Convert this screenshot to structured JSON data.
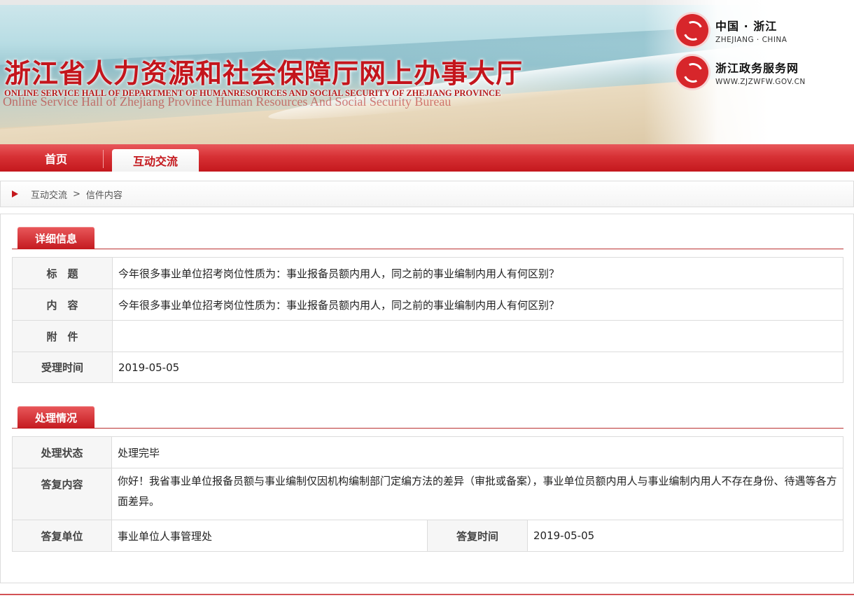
{
  "header": {
    "title": "浙江省人力资源和社会保障厅网上办事大厅",
    "subtitle_en": "ONLINE SERVICE HALL OF DEPARTMENT OF HUMANRESOURCES AND SOCIAL SECURITY OF ZHEJIANG PROVINCE",
    "subtitle_en_2": "Online Service Hall of Zhejiang Province Human Resources And Social Security Bureau",
    "badge_top": {
      "zh": "中国 · 浙江",
      "en": "ZHEJIANG · CHINA"
    },
    "badge_bottom": {
      "zh": "浙江政务服务网",
      "en": "WWW.ZJZWFW.GOV.CN"
    }
  },
  "nav": {
    "home": "首页",
    "active": "互动交流"
  },
  "breadcrumb": {
    "first": "互动交流",
    "sep": ">",
    "second": "信件内容"
  },
  "detail": {
    "heading": "详细信息",
    "rows": [
      {
        "label": "标　题",
        "value": "今年很多事业单位招考岗位性质为：事业报备员额内用人，同之前的事业编制内用人有何区别？"
      },
      {
        "label": "内　容",
        "value": "今年很多事业单位招考岗位性质为：事业报备员额内用人，同之前的事业编制内用人有何区别？"
      },
      {
        "label": "附　件",
        "value": ""
      },
      {
        "label": "受理时间",
        "value": "2019-05-05"
      }
    ]
  },
  "process": {
    "heading": "处理情况",
    "status_label": "处理状态",
    "status_value": "处理完毕",
    "reply_label": "答复内容",
    "reply_value": "你好！我省事业单位报备员额与事业编制仅因机构编制部门定编方法的差异（审批或备案），事业单位员额内用人与事业编制内用人不存在身份、待遇等各方面差异。",
    "unit_label": "答复单位",
    "unit_value": "事业单位人事管理处",
    "time_label": "答复时间",
    "time_value": "2019-05-05"
  }
}
